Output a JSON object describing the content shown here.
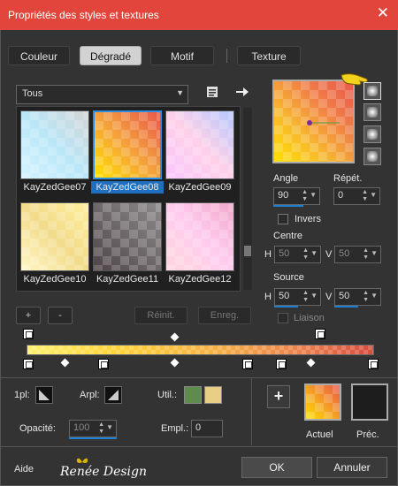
{
  "window": {
    "title": "Propriétés des styles et textures",
    "close_glyph": "✕"
  },
  "tabs": [
    {
      "label": "Couleur"
    },
    {
      "label": "Dégradé"
    },
    {
      "label": "Motif"
    },
    {
      "label": "Texture"
    }
  ],
  "category": {
    "selected": "Tous"
  },
  "thumbnails": [
    {
      "name": "KayZedGee07",
      "colors": [
        "#d6f4ff",
        "#b9e7f8",
        "#d4d4d4"
      ]
    },
    {
      "name": "KayZedGee08",
      "colors": [
        "#ffe000",
        "#f4a13c",
        "#e9584a"
      ]
    },
    {
      "name": "KayZedGee09",
      "colors": [
        "#f8c6ff",
        "#ffd0e8",
        "#b4c8ff"
      ]
    },
    {
      "name": "KayZedGee10",
      "colors": [
        "#fff7c8",
        "#f2db8a",
        "#ffef9c"
      ]
    },
    {
      "name": "KayZedGee11",
      "colors": [
        "#4c4448",
        "#6f686a",
        "#8c8a8a"
      ]
    },
    {
      "name": "KayZedGee12",
      "colors": [
        "#ffd6dd",
        "#ffccee",
        "#f0a8cc"
      ]
    }
  ],
  "preset_buttons": {
    "add": "+",
    "remove": "-",
    "reset": "Réinit.",
    "save": "Enreg."
  },
  "angle": {
    "label": "Angle",
    "value": "90"
  },
  "repeat": {
    "label": "Répét.",
    "value": "0"
  },
  "invert": {
    "label": "Invers"
  },
  "centre": {
    "label": "Centre",
    "h_label": "H",
    "h_value": "50",
    "v_label": "V",
    "v_value": "50"
  },
  "source": {
    "label": "Source",
    "h_label": "H",
    "h_value": "50",
    "v_label": "V",
    "v_value": "50"
  },
  "link": {
    "label": "Liaison"
  },
  "stops": {
    "one_pl_label": "1pl:",
    "arpl_label": "Arpl:",
    "util_label": "Util.:",
    "opacity_label": "Opacité:",
    "opacity_value": "100",
    "empl_label": "Empl.:",
    "empl_value": "0",
    "util_color_1": "#5e8c4d",
    "util_color_2": "#e9cf83"
  },
  "swatches": {
    "add_glyph": "+",
    "current_label": "Actuel",
    "previous_label": "Préc.",
    "current_colors": [
      "#ffe000",
      "#e9584a"
    ],
    "previous_color": "#1d1d1d"
  },
  "footer": {
    "help": "Aide",
    "brand": "Renée Design",
    "ok": "OK",
    "cancel": "Annuler"
  },
  "icons": {
    "folder": "bookmark-icon",
    "arrow": "arrow-right-icon",
    "hand": "pointing-hand-icon"
  }
}
